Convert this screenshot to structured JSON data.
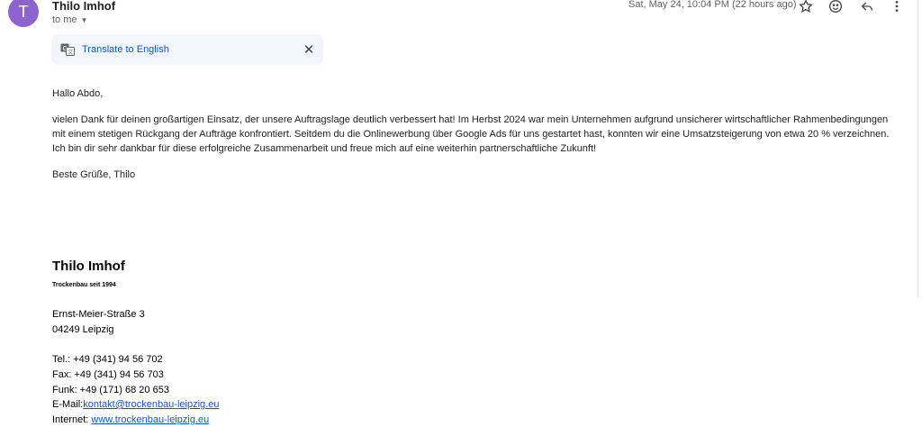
{
  "header": {
    "avatar_letter": "T",
    "avatar_color": "#8e63ce",
    "sender_name": "Thilo Imhof",
    "recipient": "to me",
    "date": "Sat, May 24, 10:04 PM (22 hours ago)",
    "icons": [
      "star-icon",
      "emoji-icon",
      "reply-icon",
      "more-vert-icon"
    ]
  },
  "translate": {
    "icon": "translate-icon",
    "link": "Translate to English",
    "close_icon": "close-icon"
  },
  "message": {
    "greeting": "Hallo Abdo,",
    "paragraph_lines": [
      "vielen Dank für deinen großartigen Einsatz, der unsere Auftragslage deutlich verbessert hat! Im Herbst 2024 war mein Unternehmen aufgrund unsicherer wirtschaftlicher Rahmenbedingungen",
      "mit einem stetigen Rückgang der Aufträge konfrontiert. Seitdem du die Onlinewerbung über Google Ads für uns gestartet hast, konnten wir eine Umsatzsteigerung von etwa 20 % verzeichnen.",
      "Ich bin dir sehr dankbar für diese erfolgreiche Zusammenarbeit und freue mich auf eine weiterhin partnerschaftliche Zukunft!"
    ],
    "closing": "Beste Grüße, Thilo"
  },
  "signature": {
    "name": "Thilo Imhof",
    "tagline": "Trockenbau seit 1994",
    "street": "Ernst-Meier-Straße 3",
    "city": "04249 Leipzig",
    "tel": "Tel.: +49 (341) 94 56 702",
    "fax": "Fax: +49 (341) 94 56 703",
    "funk": "Funk: +49 (171) 68 20 653",
    "email_label": "E-Mail:",
    "email": "kontakt@trockenbau-leipzig.eu",
    "internet_label": "Internet: ",
    "website": "www.trockenbau-leipzig.eu"
  }
}
